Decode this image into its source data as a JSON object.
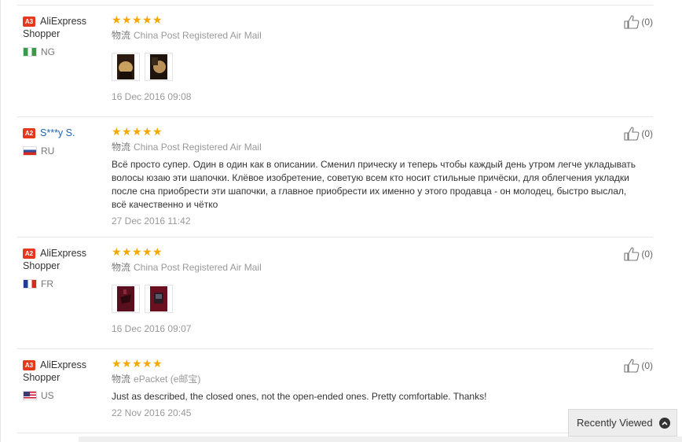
{
  "reviews": [
    {
      "badge": "A3",
      "name": "AliExpress Shopper",
      "name_is_link": false,
      "country": "NG",
      "stars": 5,
      "logistics_label": "物流",
      "logistics": "China Post Registered Air Mail",
      "text": "",
      "date": "16 Dec 2016 09:08",
      "helpful": "(0)",
      "has_images": true
    },
    {
      "badge": "A2",
      "name": "S***y S.",
      "name_is_link": true,
      "country": "RU",
      "stars": 5,
      "logistics_label": "物流",
      "logistics": "China Post Registered Air Mail",
      "text": "Всё просто супер. Один в один как в описании. Сменил прическу и теперь чтобы каждый день утром легче укладывать волосы юзаю эти шапочки. Клёвое изобретение, советую всем кто носит стильные причёски, для облегчения укладки после сна приобрести эти шапочки, а главное приобрести их именно у этого продавца - он молодец, быстро выслал, всё качественно и чётко",
      "date": "27 Dec 2016 11:42",
      "helpful": "(0)",
      "has_images": false
    },
    {
      "badge": "A2",
      "name": "AliExpress Shopper",
      "name_is_link": false,
      "country": "FR",
      "stars": 5,
      "logistics_label": "物流",
      "logistics": "China Post Registered Air Mail",
      "text": "",
      "date": "16 Dec 2016 09:07",
      "helpful": "(0)",
      "has_images": true
    },
    {
      "badge": "A3",
      "name": "AliExpress Shopper",
      "name_is_link": false,
      "country": "US",
      "stars": 5,
      "logistics_label": "物流",
      "logistics": "ePacket (e邮宝)",
      "text": "Just as described, the closed ones, not the open-ended ones. Pretty comfortable. Thanks!",
      "date": "22 Nov 2016 20:45",
      "helpful": "(0)",
      "has_images": false
    }
  ],
  "recently_viewed": "Recently Viewed",
  "colors": {
    "badge": "#e4391c",
    "star": "#f5a800",
    "link": "#1b66b0"
  }
}
